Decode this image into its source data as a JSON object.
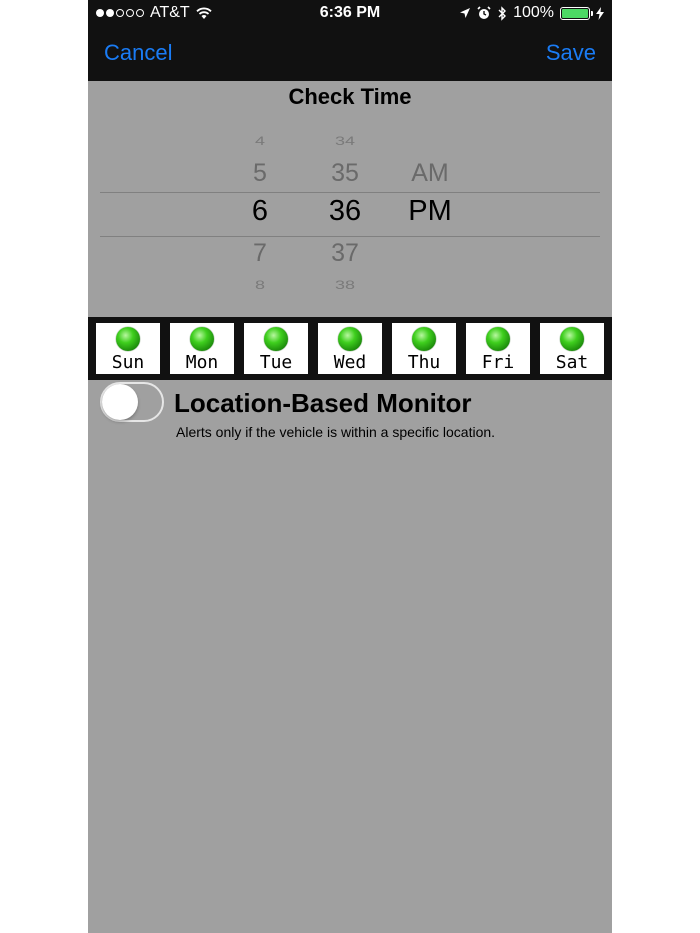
{
  "status_bar": {
    "carrier": "AT&T",
    "time": "6:36 PM",
    "battery": "100%",
    "signal_dots_on": 2,
    "signal_dots_total": 5,
    "battery_color": "#4cd964",
    "icons": [
      "wifi-icon",
      "location-arrow-icon",
      "alarm-icon",
      "bluetooth-icon",
      "battery-icon",
      "charging-bolt-icon"
    ]
  },
  "nav": {
    "cancel_label": "Cancel",
    "save_label": "Save",
    "accent_color": "#1a7cf5"
  },
  "picker": {
    "title": "Check Time",
    "hours": [
      "4",
      "5",
      "6",
      "7",
      "8"
    ],
    "minutes": [
      "34",
      "35",
      "36",
      "37",
      "38"
    ],
    "ampm": [
      "AM",
      "PM"
    ],
    "selected": {
      "hour": "6",
      "minute": "36",
      "ampm": "PM"
    }
  },
  "days": {
    "items": [
      {
        "label": "Sun",
        "enabled": true
      },
      {
        "label": "Mon",
        "enabled": true
      },
      {
        "label": "Tue",
        "enabled": true
      },
      {
        "label": "Wed",
        "enabled": true
      },
      {
        "label": "Thu",
        "enabled": true
      },
      {
        "label": "Fri",
        "enabled": true
      },
      {
        "label": "Sat",
        "enabled": true
      }
    ],
    "indicator_color": "#3fcf1e"
  },
  "location": {
    "title": "Location-Based Monitor",
    "description": "Alerts only if the vehicle is within a specific location.",
    "toggle_on": false
  }
}
